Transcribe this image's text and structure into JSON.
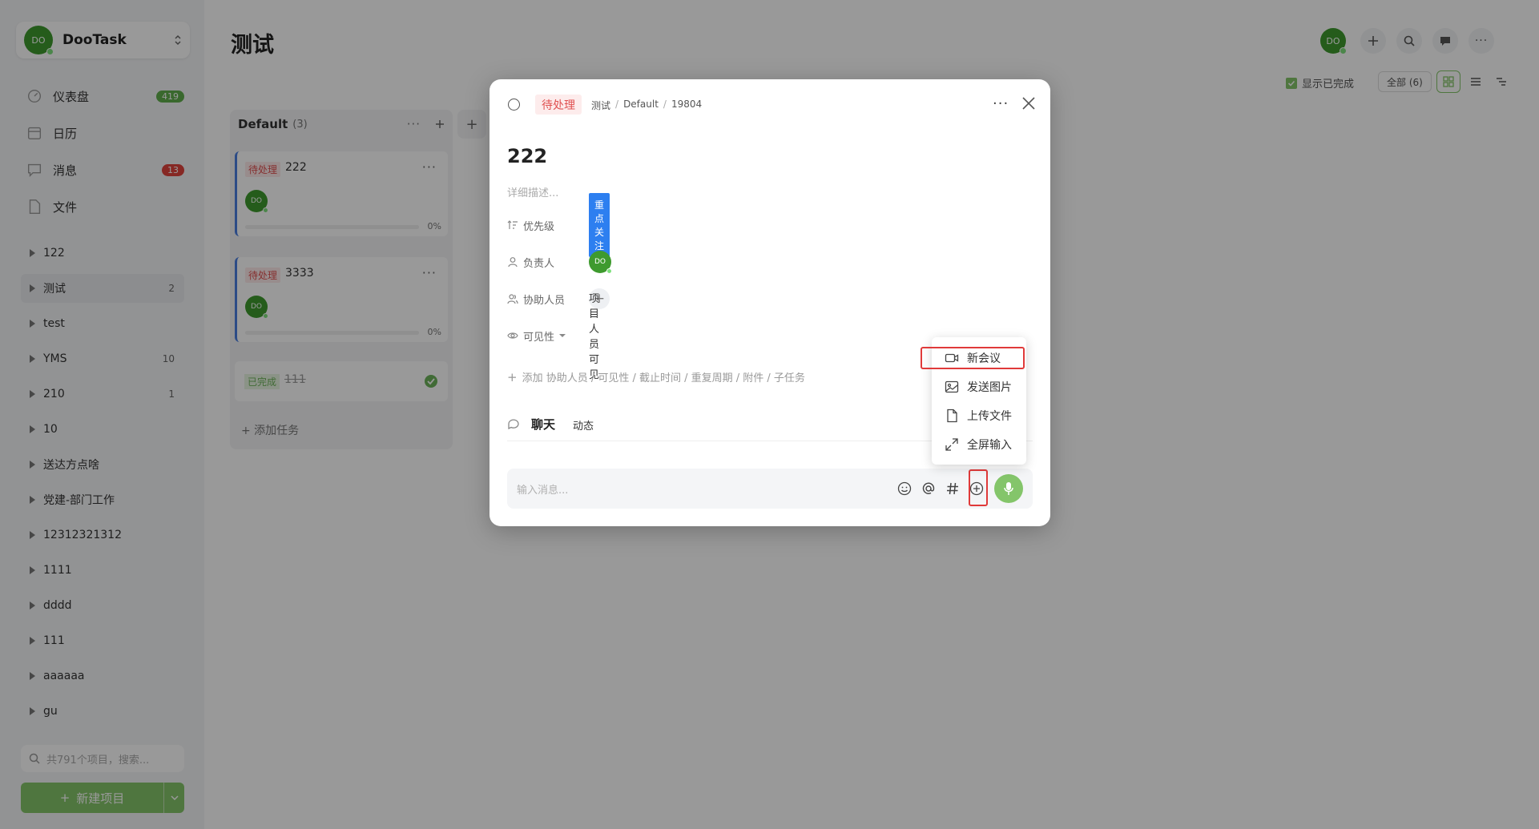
{
  "app": {
    "org_name": "DooTask",
    "avatar_initials": "DO"
  },
  "sidebar": {
    "nav": [
      {
        "label": "仪表盘",
        "icon": "dashboard-icon",
        "badge": "419",
        "badge_color": "#5fae4b"
      },
      {
        "label": "日历",
        "icon": "calendar-icon",
        "badge": "",
        "badge_color": ""
      },
      {
        "label": "消息",
        "icon": "message-icon",
        "badge": "13",
        "badge_color": "#e0443c"
      },
      {
        "label": "文件",
        "icon": "file-icon",
        "badge": "",
        "badge_color": ""
      }
    ],
    "projects": [
      {
        "name": "122",
        "count": ""
      },
      {
        "name": "测试",
        "count": "2"
      },
      {
        "name": "test",
        "count": ""
      },
      {
        "name": "YMS",
        "count": "10"
      },
      {
        "name": "210",
        "count": "1"
      },
      {
        "name": "10",
        "count": ""
      },
      {
        "name": "送达方点啥",
        "count": ""
      },
      {
        "name": "党建-部门工作",
        "count": ""
      },
      {
        "name": "12312321312",
        "count": ""
      },
      {
        "name": "1111",
        "count": ""
      },
      {
        "name": "dddd",
        "count": ""
      },
      {
        "name": "111",
        "count": ""
      },
      {
        "name": "aaaaaa",
        "count": ""
      },
      {
        "name": "gu",
        "count": ""
      }
    ],
    "search_placeholder": "共791个项目，搜索...",
    "new_project_label": "新建项目"
  },
  "main": {
    "title": "测试",
    "show_done_label": "显示已完成",
    "all_label": "全部 (6)",
    "column": {
      "name": "Default",
      "count": "(3)",
      "tasks": [
        {
          "status": "待处理",
          "title": "222",
          "progress": "0%"
        },
        {
          "status": "待处理",
          "title": "3333",
          "progress": "0%"
        }
      ],
      "done_task": {
        "status": "已完成",
        "title": "111"
      },
      "add_task_label": "+ 添加任务"
    }
  },
  "modal": {
    "status": "待处理",
    "breadcrumb": [
      "测试",
      "Default",
      "19804"
    ],
    "title": "222",
    "desc_placeholder": "详细描述...",
    "fields": {
      "priority_label": "优先级",
      "priority_value": "重点关注",
      "owner_label": "负责人",
      "helper_label": "协助人员",
      "visibility_label": "可见性",
      "visibility_value": "项目人员可见"
    },
    "more_fields": "添加 协助人员 / 可见性 / 截止时间 / 重复周期 / 附件 / 子任务",
    "tabs": {
      "chat": "聊天",
      "activity": "动态"
    },
    "input_placeholder": "输入消息..."
  },
  "popover": {
    "items": [
      {
        "label": "新会议",
        "icon": "video-icon"
      },
      {
        "label": "发送图片",
        "icon": "image-icon"
      },
      {
        "label": "上传文件",
        "icon": "file-icon"
      },
      {
        "label": "全屏输入",
        "icon": "expand-icon"
      }
    ]
  },
  "colors": {
    "accent": "#84c56a",
    "priority": "#2d7ff0",
    "highlight": "#e03a3a"
  }
}
